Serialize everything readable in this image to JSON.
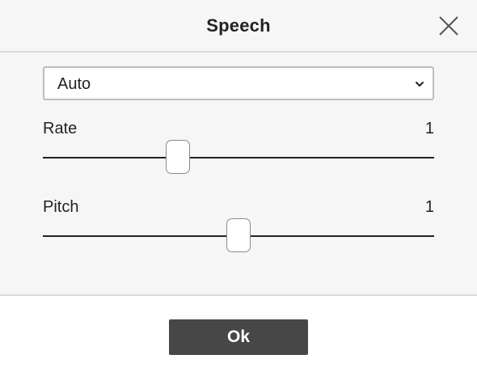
{
  "dialog": {
    "title": "Speech",
    "close_icon": "close-icon"
  },
  "voice": {
    "selected": "Auto",
    "chevron_icon": "chevron-down-icon"
  },
  "rate": {
    "label": "Rate",
    "value": "1",
    "fraction": 0.345
  },
  "pitch": {
    "label": "Pitch",
    "value": "1",
    "fraction": 0.5
  },
  "footer": {
    "ok_label": "Ok"
  },
  "colors": {
    "panel_bg": "#f6f6f6",
    "button_bg": "#474747",
    "button_text": "#ffffff",
    "divider": "#dcdcdc"
  }
}
